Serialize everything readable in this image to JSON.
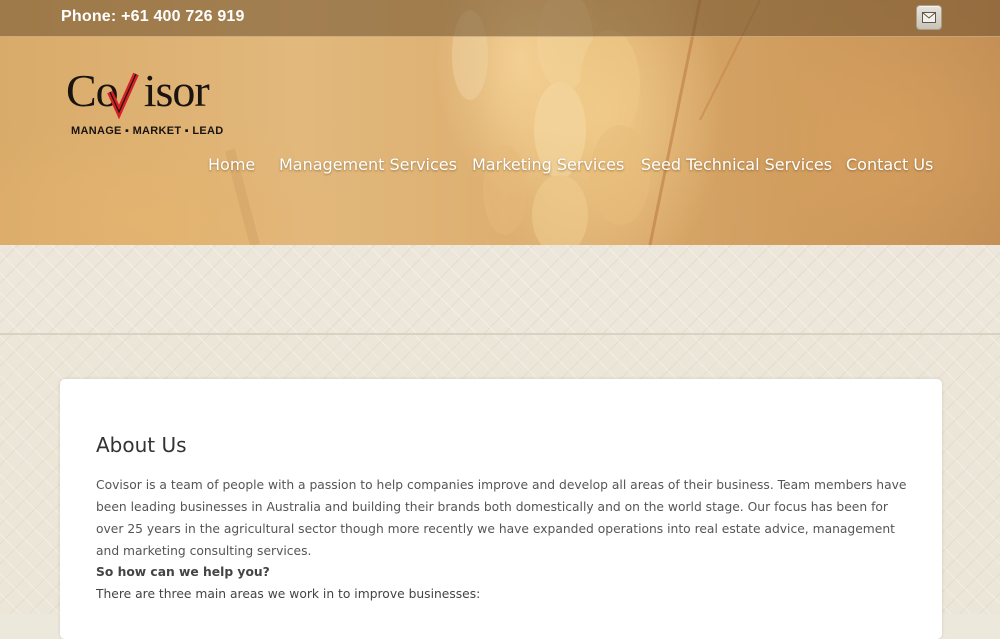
{
  "topbar": {
    "phone": "Phone: +61 400 726 919",
    "mail_icon": "envelope-icon"
  },
  "logo": {
    "word_start": "Co",
    "word_end": "isor",
    "tagline": "MANAGE ▪ MARKET ▪ LEAD"
  },
  "nav": {
    "items": [
      "Home",
      "Management Services",
      "Marketing Services",
      "Seed Technical Services",
      "Contact Us"
    ]
  },
  "about": {
    "title": "About Us",
    "body": "Covisor is a team of people with a passion to help companies improve and develop all areas of their business. Team members have been leading businesses in Australia and building their brands both domestically and on the world stage. Our focus has been for over 25 years in the agricultural sector though more recently we have expanded operations into real estate advice, management and marketing consulting services.",
    "question": "So how can we help you?",
    "areas_intro": "There are three main areas we work in to improve businesses:"
  },
  "colors": {
    "accent_red": "#d42027",
    "text_dark": "#333333",
    "topbar": "#6e502d"
  }
}
